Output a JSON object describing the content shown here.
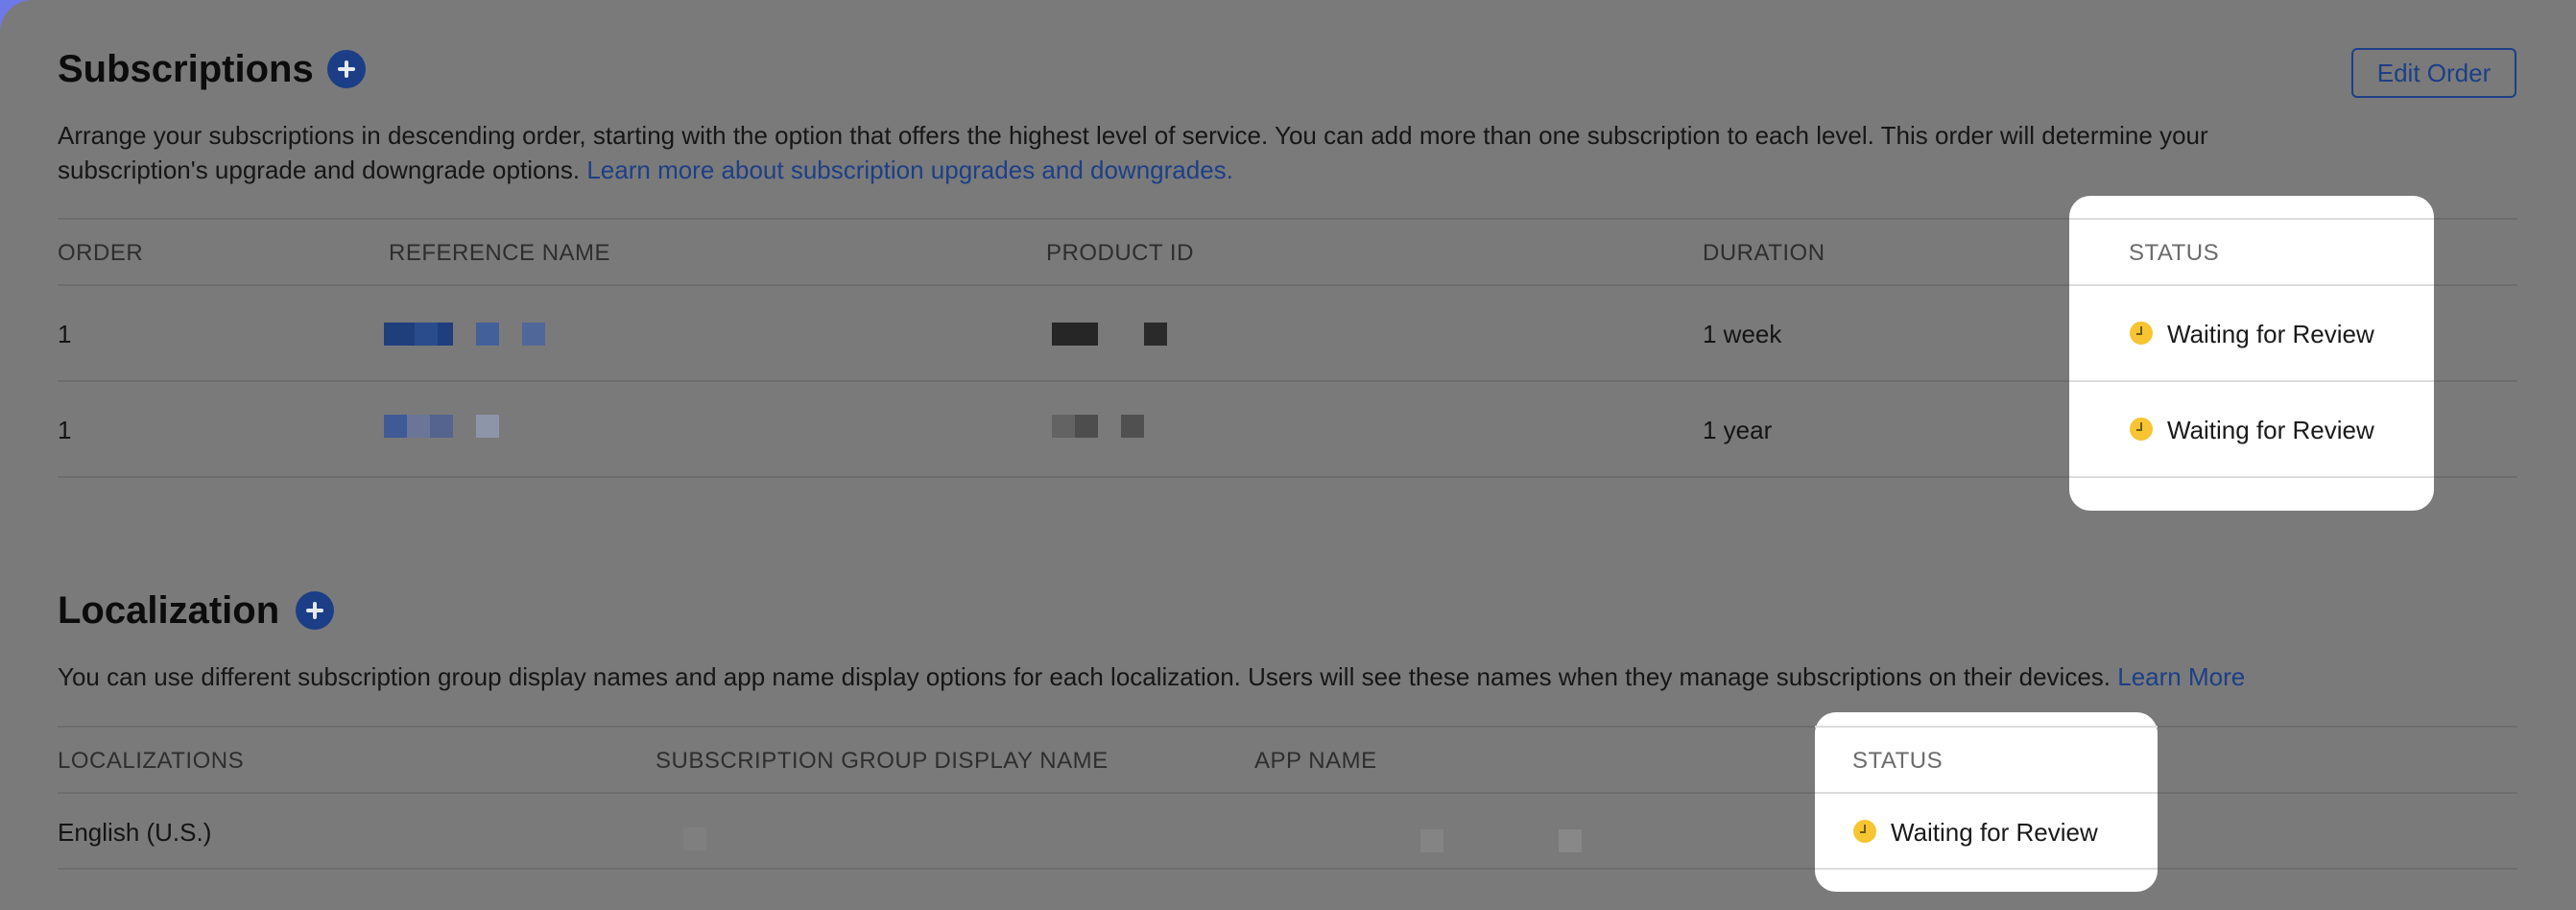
{
  "subscriptions": {
    "title": "Subscriptions",
    "add_button_label": "+",
    "edit_order_label": "Edit Order",
    "description": "Arrange your subscriptions in descending order, starting with the option that offers the highest level of service. You can add more than one subscription to each level. This order will determine your subscription's upgrade and downgrade options.",
    "learn_more_link": "Learn more about subscription upgrades and downgrades.",
    "columns": {
      "order": "ORDER",
      "reference_name": "REFERENCE NAME",
      "product_id": "PRODUCT ID",
      "duration": "DURATION",
      "status": "STATUS"
    },
    "rows": [
      {
        "order": "1",
        "duration": "1 week",
        "status": "Waiting for Review"
      },
      {
        "order": "1",
        "duration": "1 year",
        "status": "Waiting for Review"
      }
    ]
  },
  "localization": {
    "title": "Localization",
    "add_button_label": "+",
    "description": "You can use different subscription group display names and app name display options for each localization. Users will see these names when they manage subscriptions on their devices.",
    "learn_more_link": "Learn More",
    "columns": {
      "localizations": "LOCALIZATIONS",
      "display_name": "SUBSCRIPTION GROUP DISPLAY NAME",
      "app_name": "APP NAME",
      "status": "STATUS"
    },
    "rows": [
      {
        "localization": "English (U.S.)",
        "status": "Waiting for Review"
      }
    ]
  },
  "icons": {
    "add": "plus-circle-icon",
    "status": "clock-icon"
  },
  "colors": {
    "accent": "#1c3f86",
    "status_waiting": "#f6c531",
    "overlay": "#7a7a7a",
    "window_edge": "#6c79e6"
  }
}
